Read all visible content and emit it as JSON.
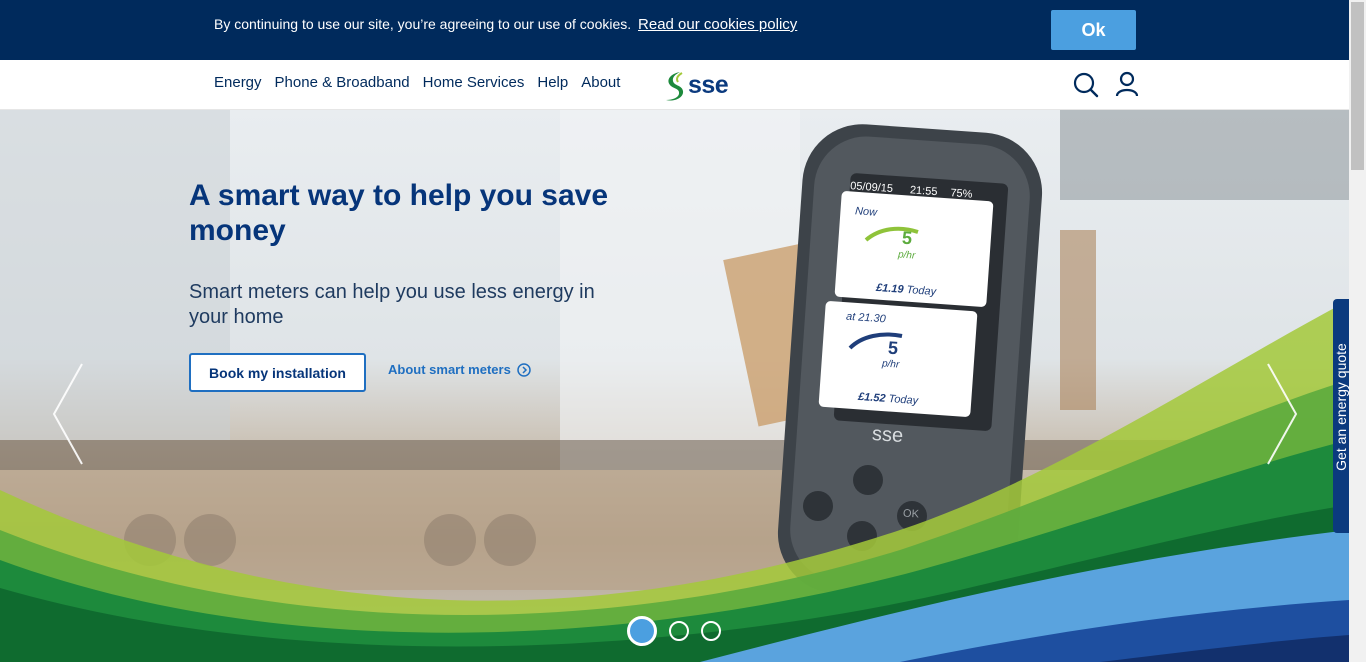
{
  "cookie_banner": {
    "text": "By continuing to use our site, you’re agreeing to our use of cookies.",
    "link": "Read our cookies policy",
    "ok_label": "Ok"
  },
  "nav": {
    "items": [
      "Energy",
      "Phone & Broadband",
      "Home Services",
      "Help",
      "About"
    ],
    "logo": "sse"
  },
  "hero": {
    "title": "A smart way to help you save money",
    "subtitle": "Smart meters can help you use less energy in your home",
    "primary_button": "Book my installation",
    "secondary_link": "About smart meters",
    "active_slide": 1,
    "slide_count": 3
  },
  "device": {
    "date": "05/09/15",
    "time": "21:55",
    "battery": "75%",
    "panel1": {
      "label": "Now",
      "value": "5",
      "unit": "p/hr",
      "today": "£1.19",
      "today_label": "Today"
    },
    "panel2": {
      "label": "at 21.30",
      "value": "5",
      "unit": "p/hr",
      "today": "£1.52",
      "today_label": "Today"
    },
    "brand": "sse",
    "ok_label": "OK"
  },
  "side_tab": {
    "label": "Get an energy quote"
  },
  "colors": {
    "navy": "#002a5c",
    "accent_blue": "#4b9fe0",
    "title_blue": "#06357a",
    "wave_green": "#1d8a3c",
    "wave_lime": "#a3c93a"
  }
}
